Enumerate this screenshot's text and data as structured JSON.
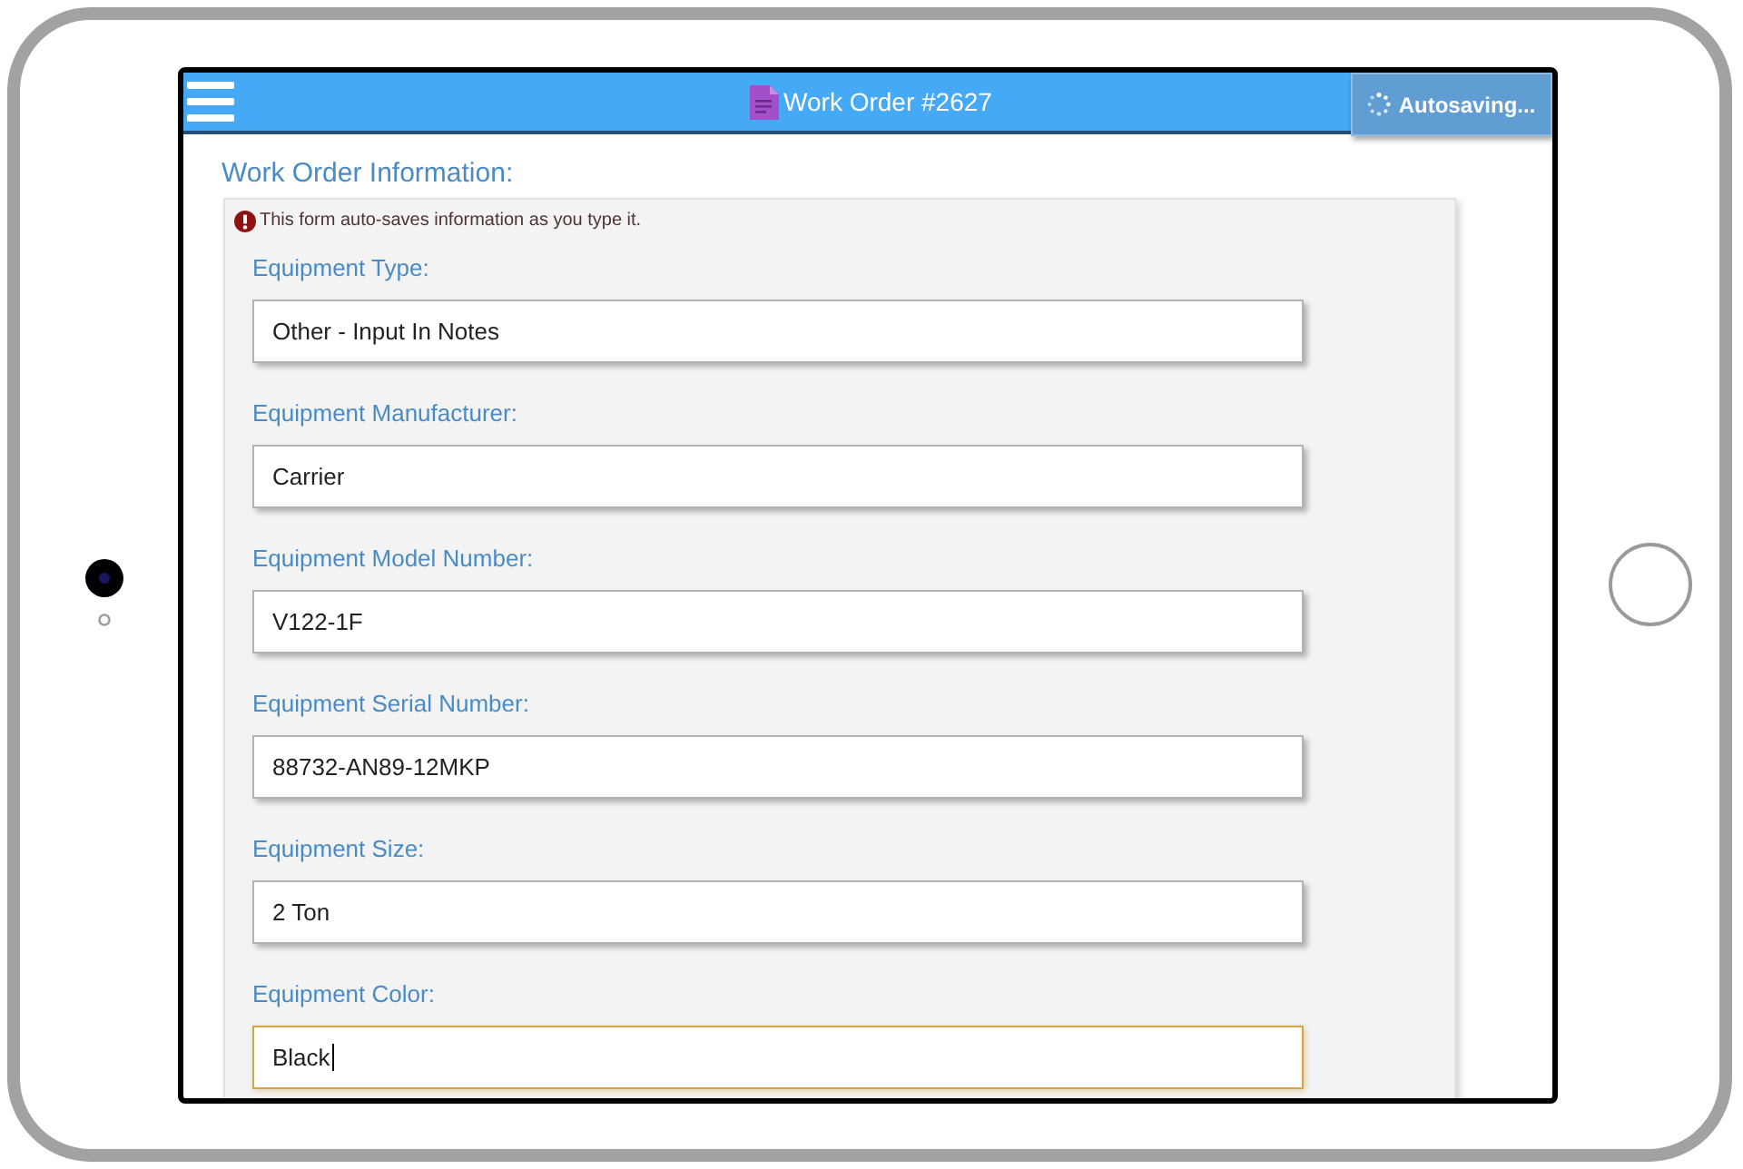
{
  "header": {
    "title": "Work Order #2627",
    "status": "Autosaving..."
  },
  "section_title": "Work Order Information:",
  "notice": "This form auto-saves information as you type it.",
  "fields": [
    {
      "label": "Equipment Type:",
      "value": "Other - Input In Notes",
      "focused": false
    },
    {
      "label": "Equipment Manufacturer:",
      "value": "Carrier",
      "focused": false
    },
    {
      "label": "Equipment Model Number:",
      "value": "V122-1F",
      "focused": false
    },
    {
      "label": "Equipment Serial Number:",
      "value": "88732-AN89-12MKP",
      "focused": false
    },
    {
      "label": "Equipment Size:",
      "value": "2 Ton",
      "focused": false
    },
    {
      "label": "Equipment Color:",
      "value": "Black",
      "focused": true
    }
  ]
}
